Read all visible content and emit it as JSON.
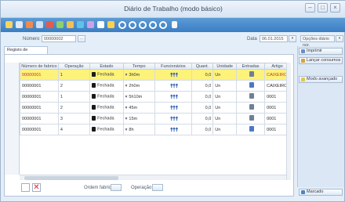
{
  "window": {
    "title": "Diário de Trabalho (modo básico)",
    "min_label": "–",
    "max_label": "□",
    "close_label": "×"
  },
  "header": {
    "numero_label": "Número",
    "numero_value": "00000002",
    "data_label": "Data",
    "data_value": "06.01.2015",
    "options_label": "Opções diário nor."
  },
  "tab": {
    "label": "Registo de operações"
  },
  "table": {
    "columns": [
      "Número de fabrico",
      "Operação",
      "Estado",
      "Tempo",
      "Funcionários",
      "Quant.",
      "Unidade",
      "Entradas",
      "Artigo"
    ],
    "rows": [
      {
        "fabrico": "00000001",
        "operacao": "1",
        "estado": "Fechada",
        "tempo": "3h0m",
        "quant": "0,0",
        "unidade": "Un",
        "artigo": "CAIXEIRO",
        "selected": true,
        "entrada_color": "gray"
      },
      {
        "fabrico": "00000001",
        "operacao": "2",
        "estado": "Fechada",
        "tempo": "2h0m",
        "quant": "0,0",
        "unidade": "Un",
        "artigo": "CAIXEIRO",
        "selected": false,
        "entrada_color": "blue"
      },
      {
        "fabrico": "00000001",
        "operacao": "1",
        "estado": "Fechada",
        "tempo": "5h10m",
        "quant": "0,0",
        "unidade": "Un",
        "artigo": "0001",
        "selected": false,
        "entrada_color": "gray"
      },
      {
        "fabrico": "00000001",
        "operacao": "2",
        "estado": "Fechada",
        "tempo": "45m",
        "quant": "0,0",
        "unidade": "Un",
        "artigo": "0001",
        "selected": false,
        "entrada_color": "gray"
      },
      {
        "fabrico": "00000001",
        "operacao": "3",
        "estado": "Fechada",
        "tempo": "15m",
        "quant": "0,0",
        "unidade": "Un",
        "artigo": "0001",
        "selected": false,
        "entrada_color": "gray"
      },
      {
        "fabrico": "00000001",
        "operacao": "4",
        "estado": "Fechada",
        "tempo": "8h",
        "quant": "0,0",
        "unidade": "Un",
        "artigo": "0001",
        "selected": false,
        "entrada_color": "blue"
      }
    ]
  },
  "footer": {
    "ordem_label": "Ordem fabrico",
    "operacao_label": "Operação"
  },
  "sidebar": {
    "btn1": "Imprimir",
    "btn2": "Lançar consumos",
    "btn3": "Modo avançado",
    "btn4": "Marcado"
  },
  "colors": {
    "toolbar": "#3a7ec3",
    "selected_row": "#fdf27a",
    "selected_text": "#c0392b"
  }
}
